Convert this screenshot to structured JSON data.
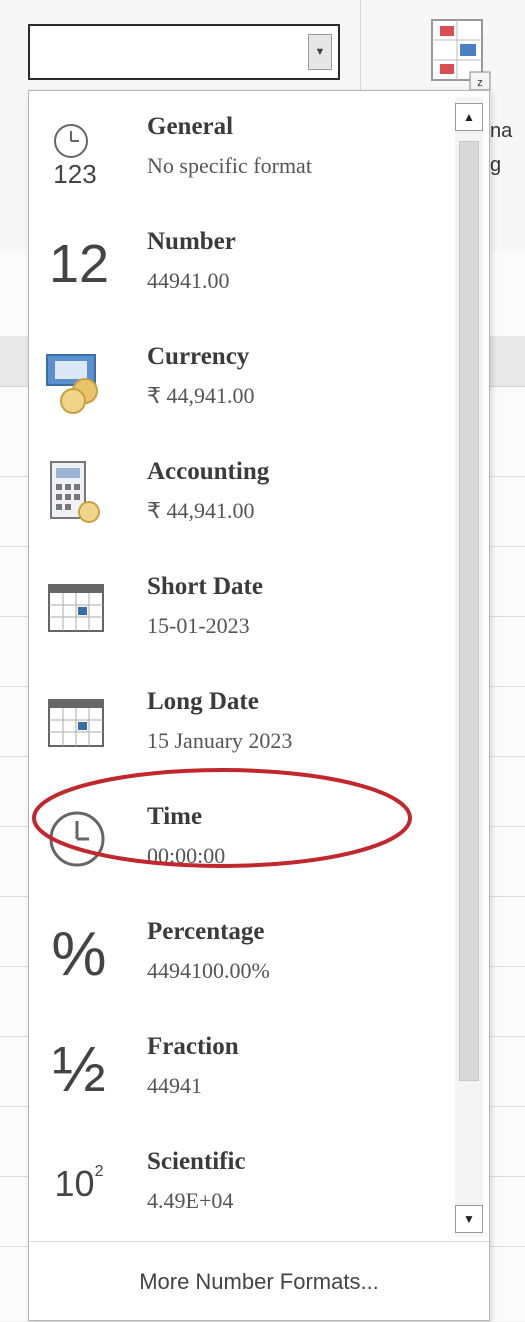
{
  "number_format_box": {
    "value": "",
    "arrow_icon": "chevron-down-icon"
  },
  "side_text": {
    "line1": "na",
    "line2": "g"
  },
  "menu": {
    "items": [
      {
        "name": "General",
        "sample": "No specific format",
        "icon": "clock-123-icon"
      },
      {
        "name": "Number",
        "sample": "44941.00",
        "icon": "number-12-icon"
      },
      {
        "name": "Currency",
        "sample": "₹ 44,941.00",
        "icon": "currency-icon"
      },
      {
        "name": "Accounting",
        "sample": "₹ 44,941.00",
        "icon": "accounting-icon"
      },
      {
        "name": "Short Date",
        "sample": "15-01-2023",
        "icon": "calendar-icon"
      },
      {
        "name": "Long Date",
        "sample": "15 January 2023",
        "icon": "calendar-icon"
      },
      {
        "name": "Time",
        "sample": "00:00:00",
        "icon": "clock-icon"
      },
      {
        "name": "Percentage",
        "sample": "4494100.00%",
        "icon": "percent-icon"
      },
      {
        "name": "Fraction",
        "sample": "44941",
        "icon": "fraction-icon"
      },
      {
        "name": "Scientific",
        "sample": "4.49E+04",
        "icon": "scientific-icon"
      }
    ],
    "more_formats": "More Number Formats...",
    "highlighted_item": "Long Date",
    "highlight_color": "#c1272d"
  },
  "glyphs": {
    "general": "123",
    "number": "12",
    "percent": "%",
    "fraction": "½",
    "scientific_base": "10",
    "scientific_exp": "2"
  }
}
